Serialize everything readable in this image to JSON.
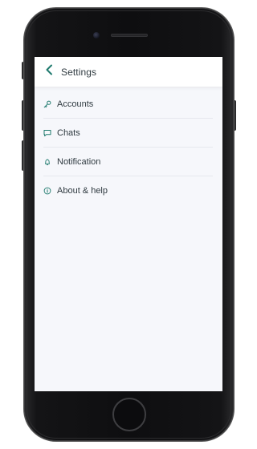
{
  "header": {
    "title": "Settings",
    "back_icon": "chevron-left-icon",
    "accent_color": "#1f7a6e"
  },
  "menu": {
    "items": [
      {
        "label": "Accounts",
        "icon": "key-icon"
      },
      {
        "label": "Chats",
        "icon": "chat-bubble-icon"
      },
      {
        "label": "Notification",
        "icon": "bell-icon"
      },
      {
        "label": "About & help",
        "icon": "info-icon"
      }
    ]
  },
  "colors": {
    "screen_background": "#f6f7fb",
    "header_background": "#ffffff",
    "text": "#2f3a40",
    "icon": "#1f7a6e"
  }
}
